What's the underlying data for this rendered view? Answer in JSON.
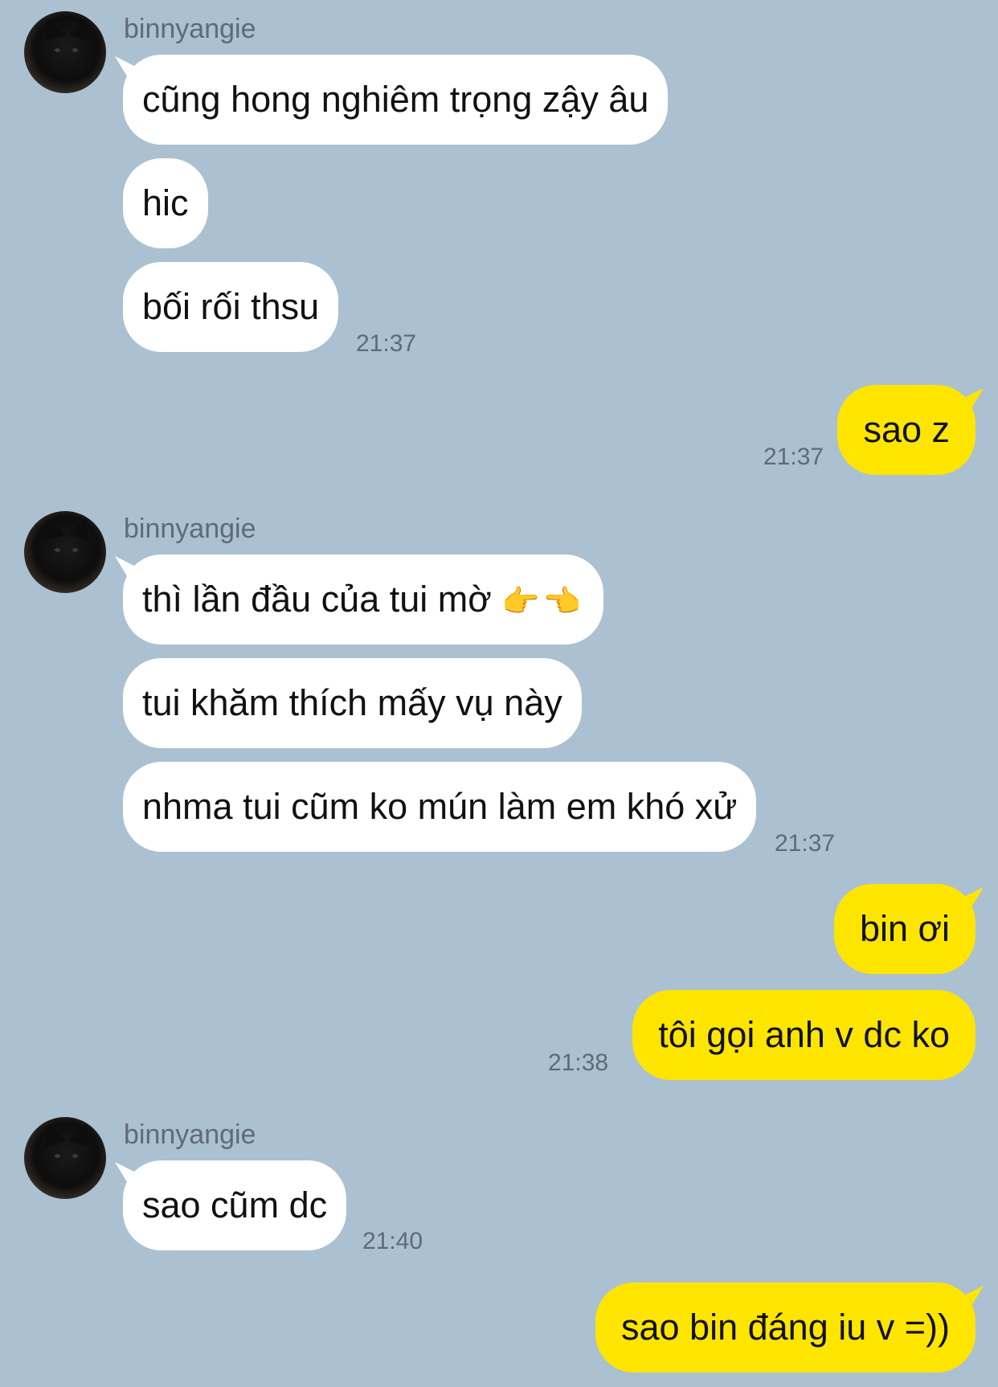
{
  "chat": {
    "groups": [
      {
        "sender": "binnyangie",
        "avatar_icon": "black-kitten-avatar",
        "messages": [
          "cũng hong nghiêm trọng zậy âu",
          "hic",
          "bối rối thsu"
        ],
        "time": "21:37"
      },
      {
        "outgoing_messages": [
          "sao z"
        ],
        "time": "21:37"
      },
      {
        "sender": "binnyangie",
        "avatar_icon": "black-kitten-avatar",
        "messages": [
          "thì lần đầu của tui mờ",
          "tui khăm thích mấy vụ này",
          "nhma tui cũm ko mún làm em khó xử"
        ],
        "emoji": "👉👈",
        "time": "21:37"
      },
      {
        "outgoing_messages": [
          "bin ơi",
          "tôi gọi anh v dc ko"
        ],
        "time": "21:38"
      },
      {
        "sender": "binnyangie",
        "avatar_icon": "black-kitten-avatar",
        "messages": [
          "sao cũm dc"
        ],
        "time": "21:40"
      },
      {
        "outgoing_messages": [
          "sao bin đáng iu v =))"
        ]
      }
    ]
  },
  "colors": {
    "background": "#abc1d1",
    "incoming_bubble": "#ffffff",
    "outgoing_bubble": "#fee500",
    "meta_text": "#5e6b76"
  }
}
